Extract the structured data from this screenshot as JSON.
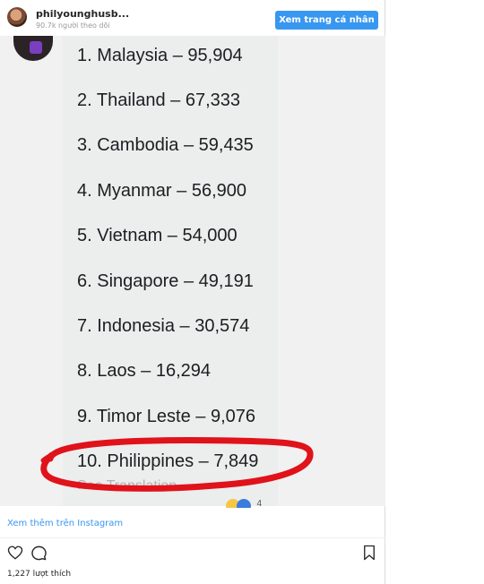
{
  "header": {
    "username": "philyounghusb...",
    "followers": "90.7k người theo dõi",
    "profile_button": "Xem trang cá nhân"
  },
  "post": {
    "list": [
      "1. Malaysia – 95,904",
      "2. Thailand – 67,333",
      "3. Cambodia – 59,435",
      "4. Myanmar – 56,900",
      "5. Vietnam – 54,000",
      "6. Singapore – 49,191",
      "7. Indonesia – 30,574",
      "8. Laos – 16,294",
      "9. Timor Leste – 9,076",
      "10. Philippines – 7,849"
    ],
    "see_translation": "See Translation",
    "reaction_count": "4"
  },
  "footer": {
    "instagram_link": "Xem thêm trên Instagram",
    "likes": "1,227 lượt thích"
  },
  "colors": {
    "accent": "#3897f0",
    "highlight": "#e0121a"
  },
  "icons": [
    "heart-icon",
    "comment-icon",
    "bookmark-icon"
  ]
}
